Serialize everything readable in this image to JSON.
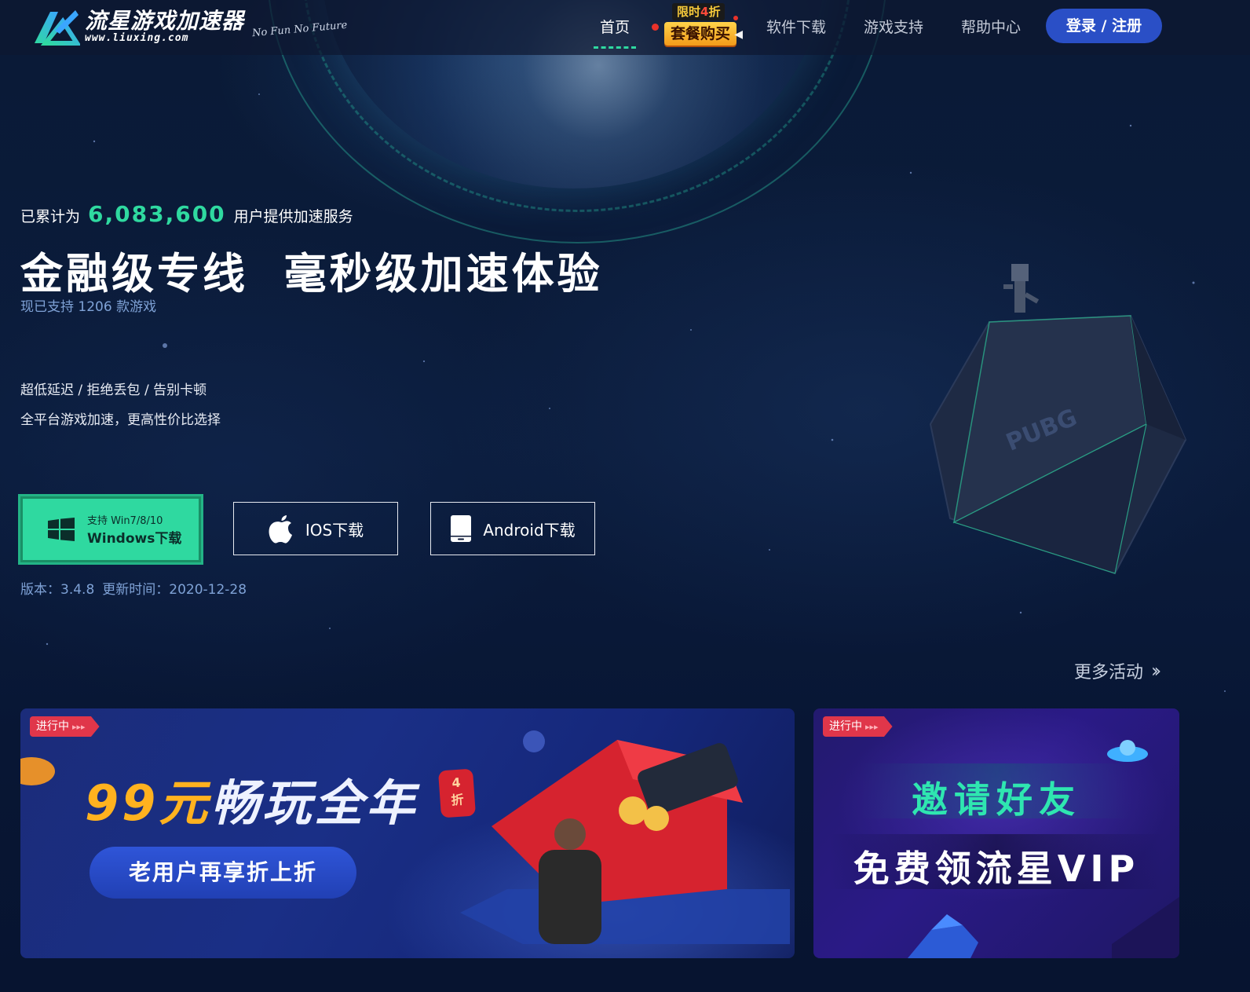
{
  "header": {
    "logo_cn": "流星游戏加速器",
    "logo_url": "www.liuxing.com",
    "slogan": "No Fun  No Future",
    "nav": {
      "home": "首页",
      "promo_top_a": "限时",
      "promo_top_b": "4",
      "promo_top_c": "折",
      "promo_main": "套餐购买",
      "software": "软件下载",
      "games": "游戏支持",
      "help": "帮助中心"
    },
    "login": "登录 / 注册"
  },
  "hero": {
    "stat_prefix": "已累计为",
    "stat_number": "6,083,600",
    "stat_suffix": "用户提供加速服务",
    "title": "金融级专线  毫秒级加速体验",
    "subtitle": "现已支持 1206 款游戏",
    "feature_line1": "超低延迟 / 拒绝丢包 / 告别卡顿",
    "feature_line2": "全平台游戏加速，更高性价比选择"
  },
  "downloads": {
    "windows_line1": "支持 Win7/8/10",
    "windows_line2": "Windows下载",
    "ios": "IOS下载",
    "android": "Android下载",
    "version": "版本：3.4.8",
    "update_time": "更新时间：2020-12-28"
  },
  "activities": {
    "more": "更多活动",
    "cards": [
      {
        "tag": "进行中",
        "headline_price": "99元",
        "headline_rest": "畅玩全年",
        "seal_num": "4",
        "seal_text": "折",
        "pill": "老用户再享折上折"
      },
      {
        "tag": "进行中",
        "line1": "邀请好友",
        "line2": "免费领流星VIP"
      }
    ]
  },
  "colors": {
    "accent_green": "#2fd9a0",
    "login_blue": "#2a4fc6",
    "subtle_blue": "#7fa2d6",
    "tag_red": "#e0364a",
    "price_orange": "#ffb21f"
  },
  "icons": {
    "logo": "liuxing-logo-icon",
    "windows": "windows-icon",
    "apple": "apple-icon",
    "android": "android-phone-icon",
    "more": "double-chevron-right-icon"
  }
}
